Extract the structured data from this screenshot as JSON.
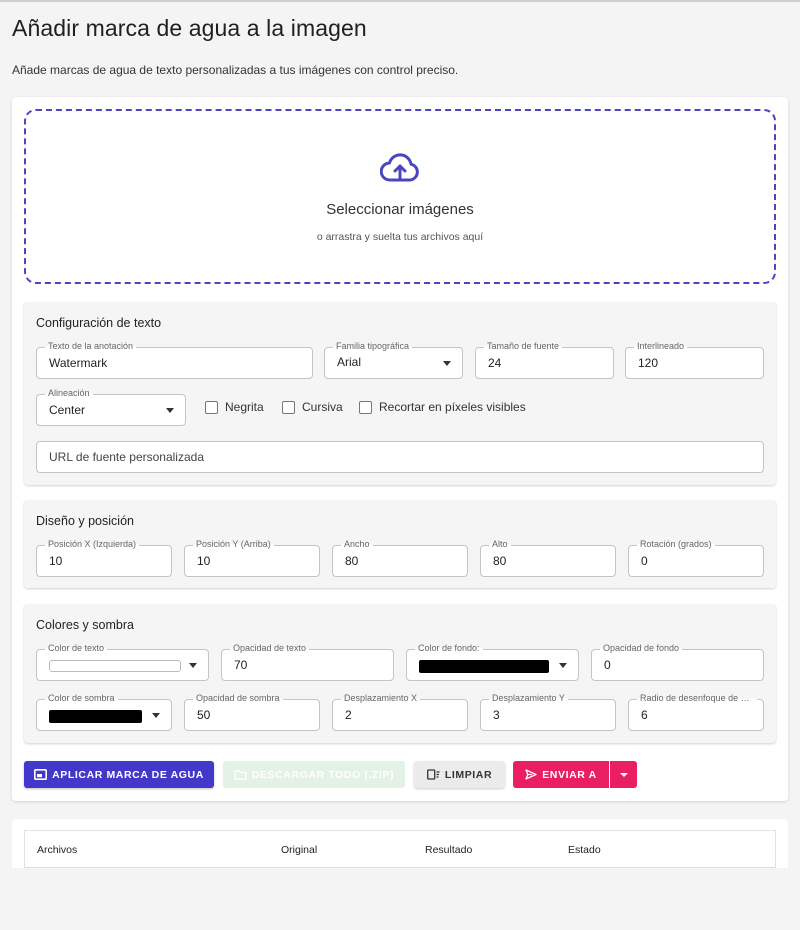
{
  "page": {
    "title": "Añadir marca de agua a la imagen",
    "subtitle": "Añade marcas de agua de texto personalizadas a tus imágenes con control preciso."
  },
  "dropzone": {
    "title": "Seleccionar imágenes",
    "subtitle": "o arrastra y suelta tus archivos aquí",
    "icon": "cloud-upload-icon",
    "accent": "#4a46c2"
  },
  "text_config": {
    "title": "Configuración de texto",
    "annotation_text": {
      "label": "Texto de la anotación",
      "value": "Watermark"
    },
    "font_family": {
      "label": "Familia tipográfica",
      "value": "Arial"
    },
    "font_size": {
      "label": "Tamaño de fuente",
      "value": "24"
    },
    "line_height": {
      "label": "Interlineado",
      "value": "120"
    },
    "alignment": {
      "label": "Alineación",
      "value": "Center"
    },
    "bold_label": "Negrita",
    "italic_label": "Cursiva",
    "crop_label": "Recortar en píxeles visibles",
    "custom_font_placeholder": "URL de fuente personalizada"
  },
  "layout": {
    "title": "Diseño y posición",
    "pos_x": {
      "label": "Posición X (Izquierda)",
      "value": "10"
    },
    "pos_y": {
      "label": "Posición Y (Arriba)",
      "value": "10"
    },
    "width": {
      "label": "Ancho",
      "value": "80"
    },
    "height": {
      "label": "Alto",
      "value": "80"
    },
    "rotation": {
      "label": "Rotación (grados)",
      "value": "0"
    }
  },
  "colors": {
    "title": "Colores y sombra",
    "text_color": {
      "label": "Color de texto",
      "value": "#ffffff"
    },
    "text_opacity": {
      "label": "Opacidad de texto",
      "value": "70"
    },
    "bg_color": {
      "label": "Color de fondo:",
      "value": "#000000"
    },
    "bg_opacity": {
      "label": "Opacidad de fondo",
      "value": "0"
    },
    "shadow_color": {
      "label": "Color de sombra",
      "value": "#000000"
    },
    "shadow_opacity": {
      "label": "Opacidad de sombra",
      "value": "50"
    },
    "offset_x": {
      "label": "Desplazamiento X",
      "value": "2"
    },
    "offset_y": {
      "label": "Desplazamiento Y",
      "value": "3"
    },
    "blur_radius": {
      "label": "Radio de desenfoque de sombra",
      "value": "6"
    }
  },
  "actions": {
    "apply_label": "APLICAR MARCA DE AGUA",
    "download_label": "DESCARGAR TODO (.ZIP)",
    "clear_label": "LIMPIAR",
    "send_label": "ENVIAR A",
    "apply_color": "#4338ca",
    "send_color": "#e91e63"
  },
  "table": {
    "columns": [
      "Archivos",
      "Original",
      "Resultado",
      "Estado"
    ]
  }
}
